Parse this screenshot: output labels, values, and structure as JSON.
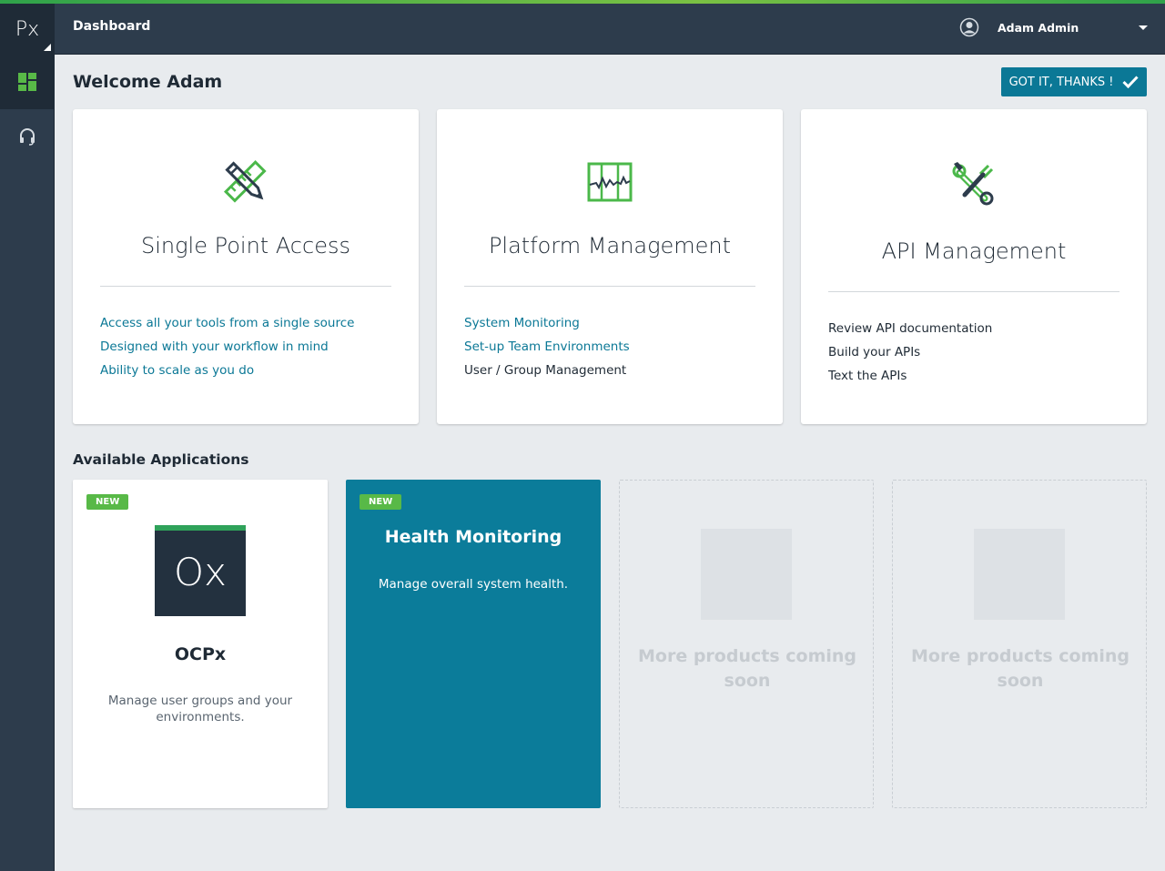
{
  "sidebar": {
    "logo_text": "Px",
    "items": [
      {
        "icon": "dashboard-grid-icon",
        "active": true
      },
      {
        "icon": "headset-icon",
        "active": false
      }
    ]
  },
  "header": {
    "title": "Dashboard",
    "user": {
      "name": "Adam Admin",
      "icon": "user-avatar-icon"
    }
  },
  "welcome": {
    "heading": "Welcome Adam",
    "dismiss_label": "GOT IT, THANKS !"
  },
  "features": [
    {
      "title": "Single Point Access",
      "icon": "ruler-pencil-icon",
      "items": [
        {
          "label": "Access all your tools from a single source",
          "link": true
        },
        {
          "label": "Designed with your workflow in mind",
          "link": true
        },
        {
          "label": "Ability to scale as you do",
          "link": true
        }
      ]
    },
    {
      "title": "Platform Management",
      "icon": "monitoring-chart-icon",
      "items": [
        {
          "label": "System Monitoring",
          "link": true
        },
        {
          "label": "Set-up Team Environments",
          "link": true
        },
        {
          "label": "User / Group Management",
          "link": false
        }
      ]
    },
    {
      "title": "API Management",
      "icon": "tools-wrench-icon",
      "items": [
        {
          "label": "Review API documentation",
          "link": false
        },
        {
          "label": "Build your APIs",
          "link": false
        },
        {
          "label": "Text the APIs",
          "link": false
        }
      ]
    }
  ],
  "applications": {
    "title": "Available Applications",
    "cards": [
      {
        "badge": "NEW",
        "logo_text": "Ox",
        "name": "OCPx",
        "description": "Manage user groups and your environments."
      },
      {
        "badge": "NEW",
        "name": "Health Monitoring",
        "description": "Manage overall system health."
      },
      {
        "placeholder": "More products coming soon"
      },
      {
        "placeholder": "More products coming soon"
      }
    ]
  },
  "colors": {
    "accent_teal": "#0b7896",
    "brand_green": "#58b947",
    "sidebar_bg": "#2d3c4c",
    "page_bg": "#e8ebee"
  }
}
